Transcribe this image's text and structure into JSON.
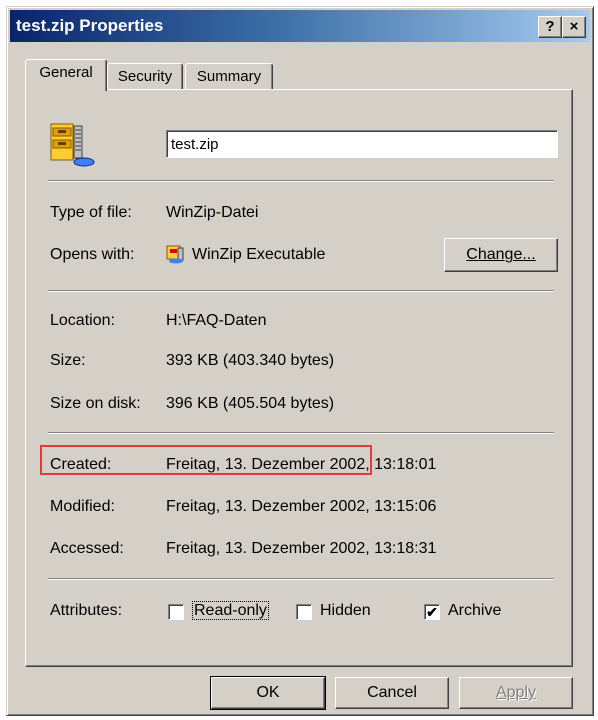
{
  "window": {
    "title": "test.zip Properties",
    "help_button": "?",
    "close_button": "×"
  },
  "tabs": [
    {
      "label": "General"
    },
    {
      "label": "Security"
    },
    {
      "label": "Summary"
    }
  ],
  "general": {
    "file_icon": "winzip-archive-icon",
    "file_name": "test.zip",
    "type_label": "Type of file:",
    "type_value": "WinZip-Datei",
    "opens_label": "Opens with:",
    "opens_icon": "winzip-app-icon",
    "opens_value": "WinZip Executable",
    "change_button": "Change...",
    "location_label": "Location:",
    "location_value": "H:\\FAQ-Daten",
    "size_label": "Size:",
    "size_value": "393 KB (403.340 bytes)",
    "size_on_disk_label": "Size on disk:",
    "size_on_disk_value": "396 KB (405.504 bytes)",
    "created_label": "Created:",
    "created_value": "Freitag, 13. Dezember 2002, 13:18:01",
    "modified_label": "Modified:",
    "modified_value": "Freitag, 13. Dezember 2002, 13:15:06",
    "accessed_label": "Accessed:",
    "accessed_value": "Freitag, 13. Dezember 2002, 13:18:31",
    "attributes_label": "Attributes:",
    "attributes": [
      {
        "label": "Read-only",
        "checked": false
      },
      {
        "label": "Hidden",
        "checked": false
      },
      {
        "label": "Archive",
        "checked": true
      }
    ]
  },
  "footer": {
    "ok": "OK",
    "cancel": "Cancel",
    "apply": "Apply"
  },
  "colors": {
    "highlight": "#e23b3b",
    "title_start": "#0a246a",
    "title_end": "#a6caf0"
  }
}
